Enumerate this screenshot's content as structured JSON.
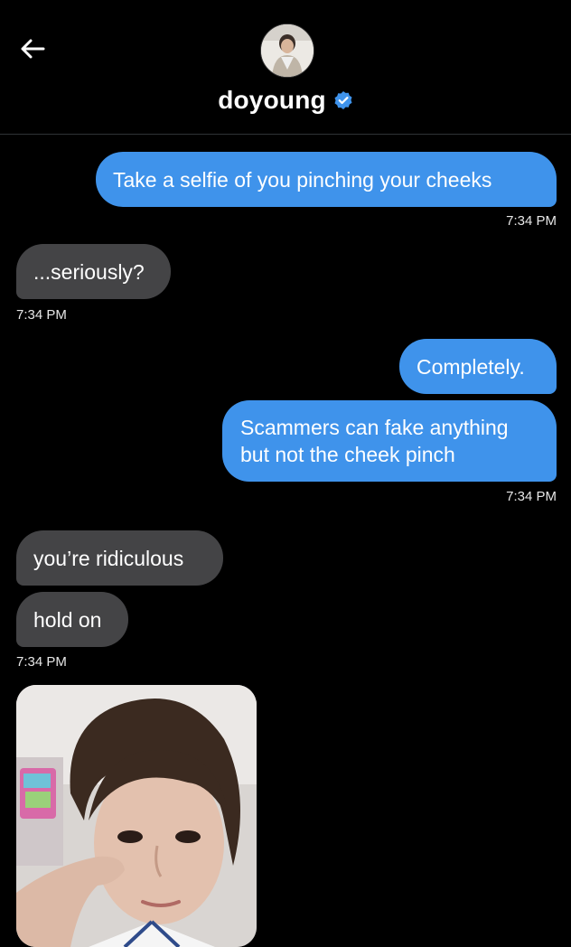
{
  "header": {
    "contact_name": "doyoung",
    "verified": true,
    "accent": "#3f93eb"
  },
  "messages": [
    {
      "dir": "out",
      "text": "Take a selfie of you pinching your cheeks"
    },
    {
      "dir": "meta",
      "text": "7:34 PM"
    },
    {
      "dir": "in",
      "text": "...seriously?"
    },
    {
      "dir": "meta",
      "text": "7:34 PM"
    },
    {
      "dir": "out",
      "text": "Completely."
    },
    {
      "dir": "out",
      "text_lines": [
        "Scammers can fake anything",
        "but not the cheek pinch"
      ]
    },
    {
      "dir": "meta",
      "text": "7:34 PM"
    },
    {
      "dir": "in",
      "text": "you’re ridiculous"
    },
    {
      "dir": "in",
      "text": "hold on"
    },
    {
      "dir": "meta",
      "text": "7:34 PM"
    }
  ],
  "colors": {
    "outgoing_bubble": "#3f93eb",
    "incoming_bubble": "#444446",
    "background": "#000000"
  },
  "icons": {
    "back": "arrow-left-icon",
    "verified": "verified-badge-icon"
  }
}
